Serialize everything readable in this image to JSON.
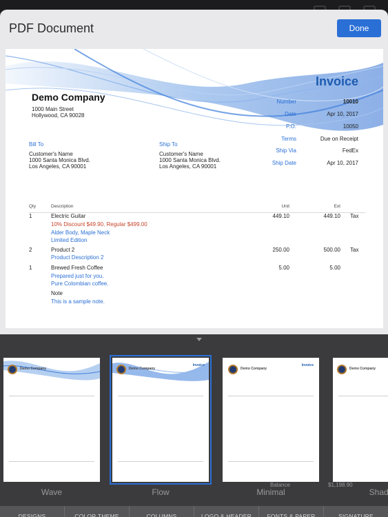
{
  "sheet": {
    "title": "PDF Document",
    "done_label": "Done"
  },
  "invoice": {
    "heading": "Invoice",
    "company": "Demo Company",
    "company_address": [
      "1000 Main Street",
      "Hollywood, CA 90028"
    ],
    "meta": [
      {
        "label": "Number",
        "value": "10010"
      },
      {
        "label": "Date",
        "value": "Apr 10, 2017"
      },
      {
        "label": "P.O.",
        "value": "10050"
      },
      {
        "label": "Terms",
        "value": "Due on Receipt"
      },
      {
        "label": "Ship Via",
        "value": "FedEx"
      },
      {
        "label": "Ship Date",
        "value": "Apr 10, 2017"
      }
    ],
    "bill_to": {
      "label": "Bill To",
      "lines": [
        "Customer's Name",
        "1000 Santa Monica Blvd.",
        "Los Angeles, CA 90001"
      ]
    },
    "ship_to": {
      "label": "Ship To",
      "lines": [
        "Customer's Name",
        "1000 Santa Monica Blvd.",
        "Los Angeles, CA 90001"
      ]
    },
    "columns": {
      "qty": "Qty",
      "description": "Description",
      "unit": "Unit",
      "ext": "Ext"
    },
    "items": [
      {
        "qty": "1",
        "name": "Electric Guitar",
        "discount": "10% Discount $49.90, Regular $499.00",
        "details": [
          "Alder Body, Maple Neck",
          "Limited Edition"
        ],
        "unit": "449.10",
        "ext": "449.10",
        "tax": "Tax"
      },
      {
        "qty": "2",
        "name": "Product 2",
        "details": [
          "Product Description 2"
        ],
        "unit": "250.00",
        "ext": "500.00",
        "tax": "Tax"
      },
      {
        "qty": "1",
        "name": "Brewed Fresh Coffee",
        "details": [
          "Prepared just for you.",
          "Pure Colombian coffee."
        ],
        "unit": "5.00",
        "ext": "5.00",
        "tax": ""
      }
    ],
    "note_label": "Note",
    "note_text": "This is a sample note."
  },
  "designs": [
    {
      "label": "Wave",
      "selected": false
    },
    {
      "label": "Flow",
      "selected": true
    },
    {
      "label": "Minimal",
      "selected": false
    },
    {
      "label": "Shado",
      "selected": false
    }
  ],
  "thumb_overlays": {
    "balance": "Balance",
    "amount": "$1,198.90"
  },
  "tabs": [
    "DESIGNS",
    "COLOR THEME",
    "COLUMNS",
    "LOGO & HEADER",
    "FONTS & PAPER",
    "SIGNATURE"
  ],
  "colors": {
    "accent": "#2a6fd6",
    "invoice_title": "#1e5bb0",
    "discount": "#c8432b",
    "wave": "#3f7fdc"
  }
}
